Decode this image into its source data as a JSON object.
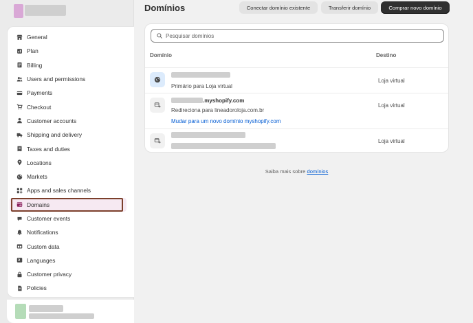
{
  "sidebar": {
    "items": [
      {
        "name": "general",
        "label": "General",
        "icon": "store-icon"
      },
      {
        "name": "plan",
        "label": "Plan",
        "icon": "plan-icon"
      },
      {
        "name": "billing",
        "label": "Billing",
        "icon": "billing-icon"
      },
      {
        "name": "users",
        "label": "Users and permissions",
        "icon": "users-icon"
      },
      {
        "name": "payments",
        "label": "Payments",
        "icon": "payments-icon"
      },
      {
        "name": "checkout",
        "label": "Checkout",
        "icon": "cart-icon"
      },
      {
        "name": "customer-accounts",
        "label": "Customer accounts",
        "icon": "person-icon"
      },
      {
        "name": "shipping",
        "label": "Shipping and delivery",
        "icon": "truck-icon"
      },
      {
        "name": "taxes",
        "label": "Taxes and duties",
        "icon": "receipt-icon"
      },
      {
        "name": "locations",
        "label": "Locations",
        "icon": "pin-icon"
      },
      {
        "name": "markets",
        "label": "Markets",
        "icon": "globe-icon"
      },
      {
        "name": "apps",
        "label": "Apps and sales channels",
        "icon": "apps-icon"
      },
      {
        "name": "domains",
        "label": "Domains",
        "icon": "domains-icon",
        "active": true
      },
      {
        "name": "customer-events",
        "label": "Customer events",
        "icon": "events-icon"
      },
      {
        "name": "notifications",
        "label": "Notifications",
        "icon": "bell-icon"
      },
      {
        "name": "custom-data",
        "label": "Custom data",
        "icon": "data-icon"
      },
      {
        "name": "languages",
        "label": "Languages",
        "icon": "language-icon"
      },
      {
        "name": "customer-privacy",
        "label": "Customer privacy",
        "icon": "lock-icon"
      },
      {
        "name": "policies",
        "label": "Policies",
        "icon": "policy-icon"
      }
    ]
  },
  "header": {
    "title": "Domínios",
    "connect_label": "Conectar domínio existente",
    "transfer_label": "Transferir domínio",
    "buy_label": "Comprar novo domínio"
  },
  "domains_card": {
    "search_placeholder": "Pesquisar domínios",
    "col_domain": "Domínio",
    "col_dest": "Destino",
    "rows": [
      {
        "subtitle": "Primário para Loja virtual",
        "destination": "Loja virtual"
      },
      {
        "domain_suffix": ".myshopify.com",
        "subtitle": "Redireciona para lineadoroloja.com.br",
        "link": "Mudar para um novo domínio myshopify.com",
        "destination": "Loja virtual"
      },
      {
        "destination": "Loja virtual"
      }
    ]
  },
  "footer": {
    "learn_prefix": "Saiba mais sobre",
    "learn_link": "domínios"
  },
  "colors": {
    "primary_button": "#303030",
    "link": "#005bd3",
    "active_nav": "#f6e9f2",
    "highlight_box": "#7b3f2b"
  }
}
